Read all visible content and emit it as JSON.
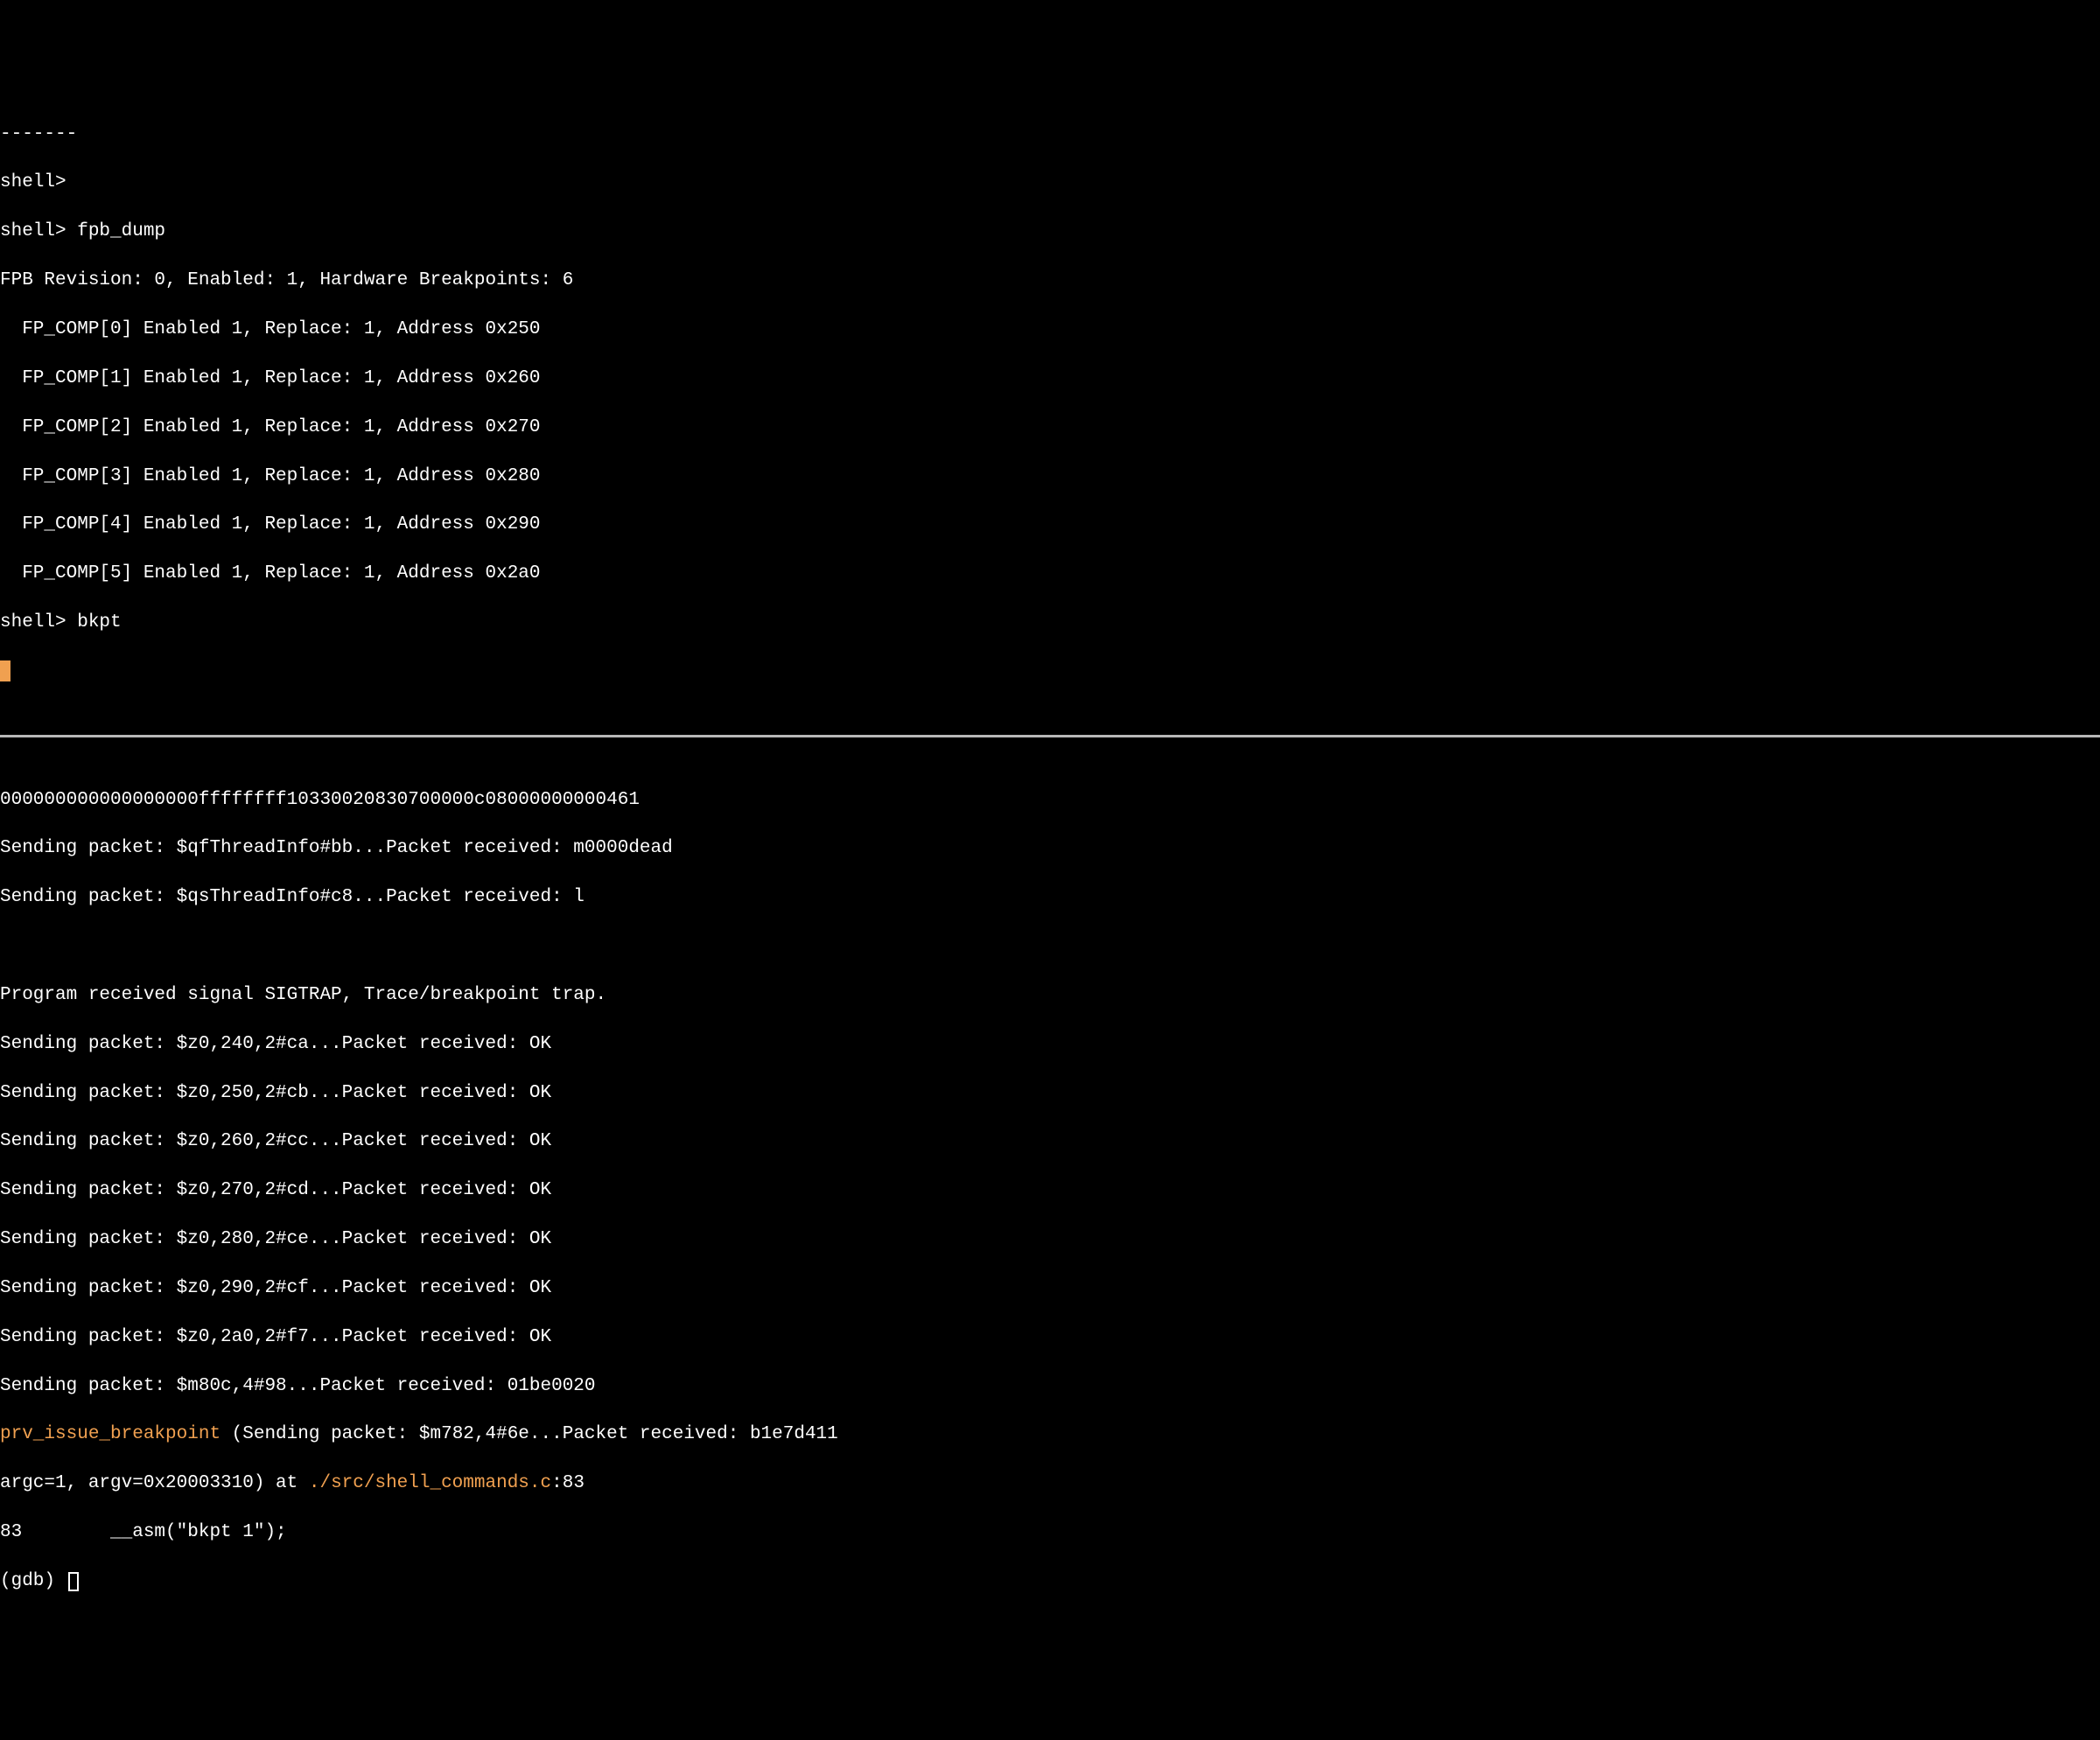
{
  "top_pane": {
    "l0": "-------",
    "l1": "shell>",
    "l2": "shell> fpb_dump",
    "l3": "FPB Revision: 0, Enabled: 1, Hardware Breakpoints: 6",
    "l4": "  FP_COMP[0] Enabled 1, Replace: 1, Address 0x250",
    "l5": "  FP_COMP[1] Enabled 1, Replace: 1, Address 0x260",
    "l6": "  FP_COMP[2] Enabled 1, Replace: 1, Address 0x270",
    "l7": "  FP_COMP[3] Enabled 1, Replace: 1, Address 0x280",
    "l8": "  FP_COMP[4] Enabled 1, Replace: 1, Address 0x290",
    "l9": "  FP_COMP[5] Enabled 1, Replace: 1, Address 0x2a0",
    "l10": "shell> bkpt"
  },
  "bottom_pane": {
    "l0": "000000000000000000ffffffff10330020830700000c08000000000461",
    "l1": "Sending packet: $qfThreadInfo#bb...Packet received: m0000dead",
    "l2": "Sending packet: $qsThreadInfo#c8...Packet received: l",
    "l3": "",
    "l4": "Program received signal SIGTRAP, Trace/breakpoint trap.",
    "l5": "Sending packet: $z0,240,2#ca...Packet received: OK",
    "l6": "Sending packet: $z0,250,2#cb...Packet received: OK",
    "l7": "Sending packet: $z0,260,2#cc...Packet received: OK",
    "l8": "Sending packet: $z0,270,2#cd...Packet received: OK",
    "l9": "Sending packet: $z0,280,2#ce...Packet received: OK",
    "l10": "Sending packet: $z0,290,2#cf...Packet received: OK",
    "l11": "Sending packet: $z0,2a0,2#f7...Packet received: OK",
    "l12": "Sending packet: $m80c,4#98...Packet received: 01be0020",
    "l13_hl": "prv_issue_breakpoint",
    "l13_rest": " (Sending packet: $m782,4#6e...Packet received: b1e7d411",
    "l14_a": "argc=1, argv=0x20003310) at ",
    "l14_hl": "./src/shell_commands.c",
    "l14_b": ":83",
    "l15": "83        __asm(\"bkpt 1\");",
    "l16": "(gdb) "
  }
}
